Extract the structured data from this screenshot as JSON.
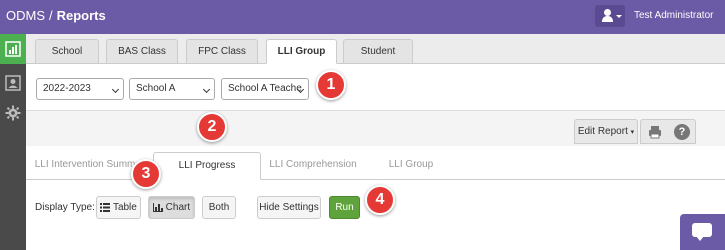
{
  "topbar": {
    "app": "ODMS",
    "separator": "/",
    "page": "Reports",
    "user_name": "Test Administrator"
  },
  "top_tabs": [
    "School",
    "BAS Class",
    "FPC Class",
    "LLI Group",
    "Student"
  ],
  "filters": {
    "year": "2022-2023",
    "school": "School A",
    "teacher": "School A Teache"
  },
  "toolbar": {
    "edit_report": "Edit Report",
    "help": "?"
  },
  "report_tabs": [
    "LLI Intervention Summary",
    "LLI Progress Monitoring",
    "LLI Comprehension",
    "LLI Group Attendance"
  ],
  "controls": {
    "display_type_label": "Display Type:",
    "table": "Table",
    "chart": "Chart",
    "both": "Both",
    "hide_settings": "Hide Settings",
    "run": "Run"
  },
  "callouts": [
    "1",
    "2",
    "3",
    "4"
  ],
  "colors": {
    "brand": "#6b5aa6",
    "active_sidebar": "#4caf50",
    "run_button": "#5ea33b",
    "callout": "#e53935"
  },
  "icons": {
    "user": "user-icon",
    "reports": "chart-icon",
    "profile": "profile-icon",
    "settings": "gear-icon",
    "print": "printer-icon",
    "help": "help-icon",
    "chat": "chat-icon"
  }
}
